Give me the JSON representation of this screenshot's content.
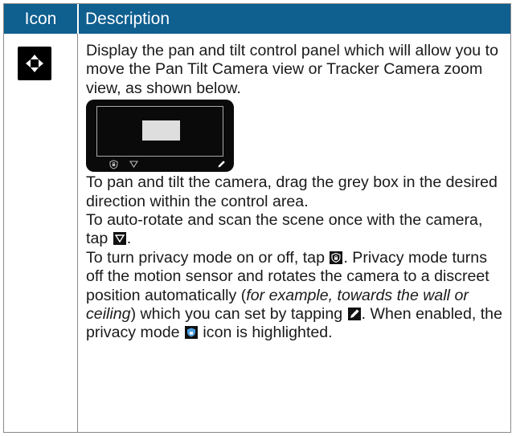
{
  "header": {
    "icon_col": "Icon",
    "description_col": "Description"
  },
  "row": {
    "icon": "pan-tilt-arrows-icon",
    "intro": "Display the pan and tilt control panel which will allow you to move the Pan Tilt Camera view or Tracker Camera zoom view, as shown below.",
    "panel_icons": [
      "privacy-shield-icon",
      "scan-icon",
      "pencil-icon"
    ],
    "drag_text": "To pan and tilt the camera, drag the grey box in the desired direction within the control area.",
    "scan_text_before": "To auto-rotate and scan the scene once with the camera, tap ",
    "scan_text_after": ".",
    "privacy_text_1": "To turn privacy mode on or off, tap ",
    "privacy_text_2": ". Privacy mode turns off the motion sensor and rotates the camera to a discreet position automatically (",
    "privacy_italic": "for example, towards the wall or ceiling",
    "privacy_text_3": ") which you can set by tapping ",
    "privacy_text_4": ". When enabled, the privacy mode ",
    "privacy_text_5": " icon is highlighted.",
    "highlight_color": "#4a9ee0"
  }
}
